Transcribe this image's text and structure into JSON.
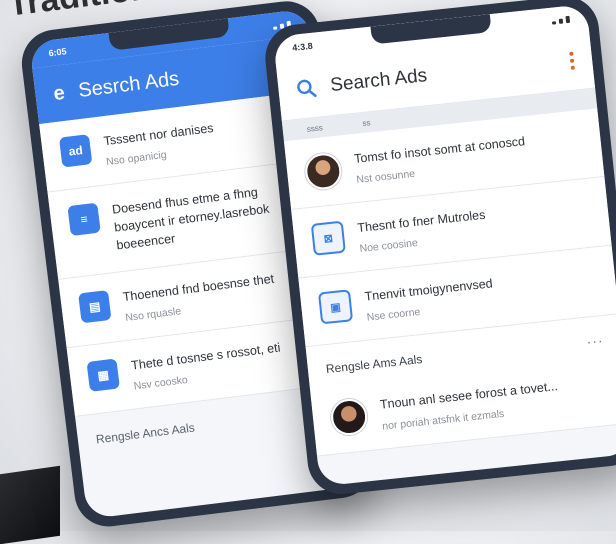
{
  "headline": "Traditional S",
  "left_phone": {
    "status_time": "6:05",
    "app_title": "Sesrch Ads",
    "app_icon": "e-logo-icon",
    "items": [
      {
        "icon": "ad-icon",
        "glyph": "ad",
        "title": "Tsssent nor danises",
        "subtitle": "Nso opanicig"
      },
      {
        "icon": "list-icon",
        "glyph": "≡",
        "title": "Doesend fhus etme a fhng boaycent ir etorney.lasrebok boeeencer",
        "subtitle": ""
      },
      {
        "icon": "document-icon",
        "glyph": "▤",
        "title": "Thoenend fnd boesnse thet",
        "subtitle": "Nso rquasle"
      },
      {
        "icon": "grid-icon",
        "glyph": "▦",
        "title": "Thete d tosnse s rossot, eti",
        "subtitle": "Nsv coosko"
      }
    ],
    "footer_label": "Rengsle Ancs Aals"
  },
  "right_phone": {
    "status_time": "4:3.8",
    "search_title": "Search Ads",
    "tab_labels": [
      "ssss",
      "ss"
    ],
    "items": [
      {
        "type": "avatar",
        "title": "Tomst fo insot somt at conoscd",
        "subtitle": "Nst oosunne"
      },
      {
        "type": "icon",
        "glyph": "⊠",
        "title": "Thesnt fo fner Mutroles",
        "subtitle": "Noe coosine"
      },
      {
        "type": "icon",
        "glyph": "▣",
        "title": "Tnenvit tmoigynenvsed",
        "subtitle": "Nse coorne"
      }
    ],
    "section_title": "Rengsle Ams Aals",
    "section_item": {
      "title": "Tnoun anl sesee forost a tovet...",
      "subtitle": "nor poriah atsfnk it ezmals"
    }
  },
  "colors": {
    "accent": "#3d7fe8",
    "frame": "#2c3545",
    "menu_dots": "#d36b2a"
  }
}
